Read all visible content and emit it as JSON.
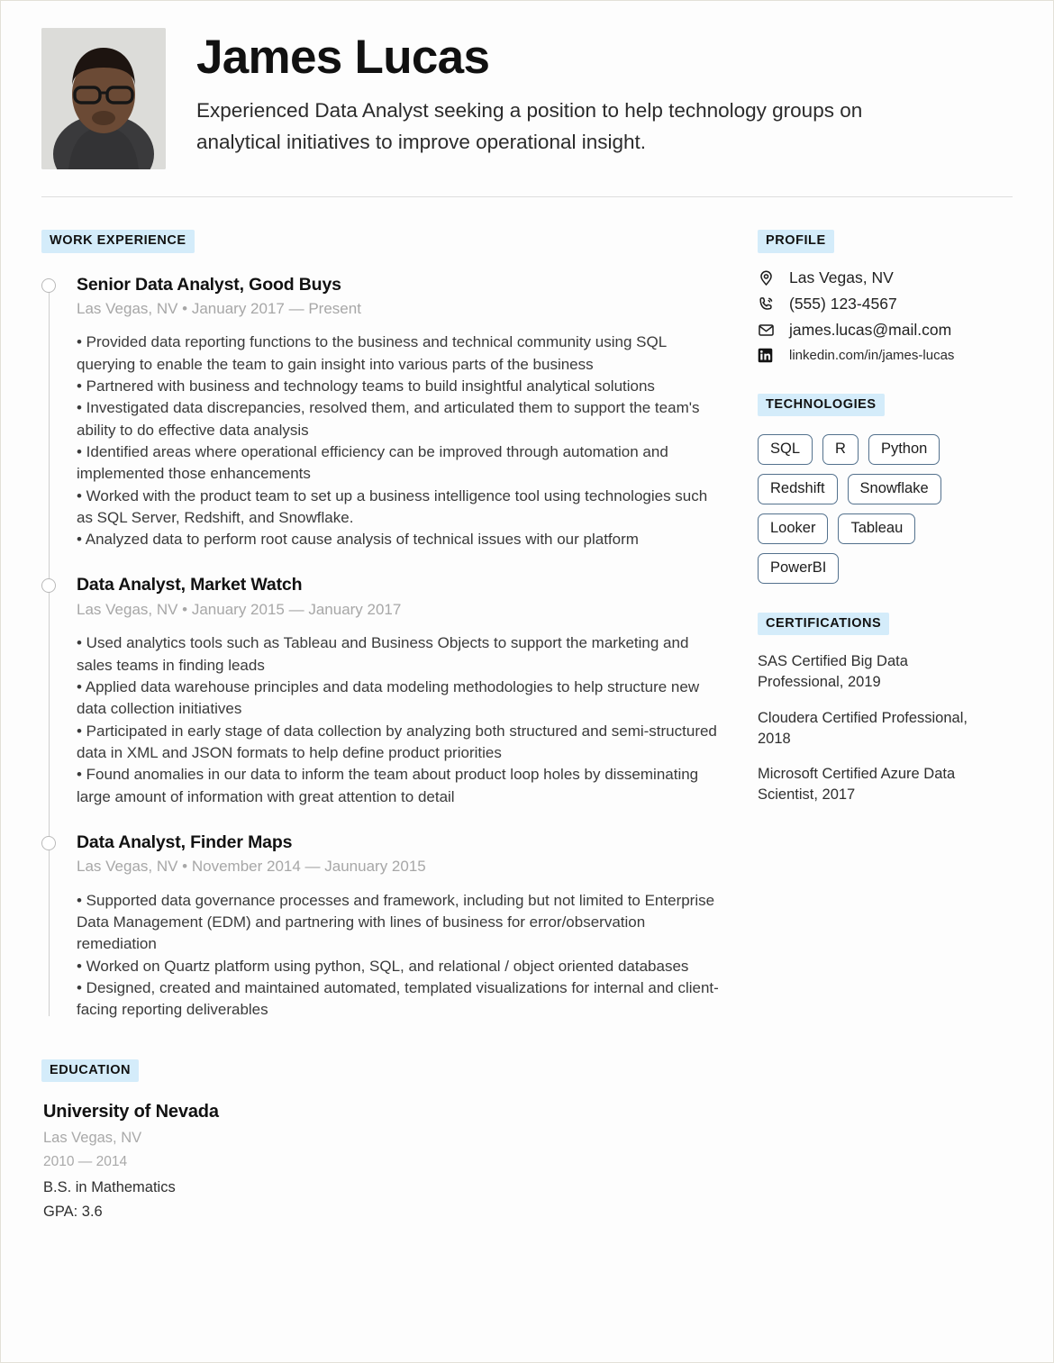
{
  "theme": {
    "chip_bg": "#d4ecfa",
    "tag_border": "#53718d",
    "muted_text": "#a7a7a7",
    "body_text": "#3a3a3a"
  },
  "header": {
    "name": "James Lucas",
    "tagline": "Experienced Data Analyst seeking a position to help technology groups on analytical initiatives to improve operational insight.",
    "photo_alt": "profile-photo"
  },
  "work": {
    "section_label": "WORK EXPERIENCE",
    "jobs": [
      {
        "title": "Senior Data Analyst, Good Buys",
        "meta": "Las Vegas, NV • January 2017 — Present",
        "bullets": [
          "• Provided data reporting functions to the business and technical community using SQL querying to enable the team to gain insight into various parts of the business",
          "• Partnered with business and technology teams to build insightful analytical solutions",
          "• Investigated data discrepancies, resolved them, and articulated them to support the team's ability to do effective data analysis",
          "• Identified areas where operational efficiency can be improved through automation and implemented those enhancements",
          "• Worked with the product team to set up a business intelligence tool using technologies such as SQL Server, Redshift, and Snowflake.",
          "• Analyzed data to perform root cause analysis of technical issues with our platform"
        ]
      },
      {
        "title": "Data Analyst, Market Watch",
        "meta": "Las Vegas, NV • January 2015 — January 2017",
        "bullets": [
          "• Used analytics tools such as Tableau and Business Objects to support the marketing and sales teams in finding leads",
          "• Applied data warehouse principles and data modeling methodologies to help structure new data collection initiatives",
          "• Participated in early stage of data collection by analyzing both structured and semi-structured data in XML and JSON formats to help define product priorities",
          "• Found anomalies in our data to inform the team about product loop holes by disseminating large amount of information with great attention to detail"
        ]
      },
      {
        "title": "Data Analyst, Finder Maps",
        "meta": "Las Vegas, NV • November 2014 — Jaunuary 2015",
        "bullets": [
          "• Supported data governance processes and framework, including but not limited to Enterprise Data Management (EDM) and partnering with lines of business for error/observation remediation",
          "• Worked on Quartz platform using python, SQL, and relational / object oriented databases",
          "• Designed, created and maintained automated, templated visualizations for internal and client-facing reporting deliverables"
        ]
      }
    ]
  },
  "education": {
    "section_label": "EDUCATION",
    "school": "University of Nevada",
    "location": "Las Vegas, NV",
    "years": "2010 — 2014",
    "degree": "B.S. in Mathematics",
    "gpa": "GPA: 3.6"
  },
  "profile": {
    "section_label": "PROFILE",
    "contacts": [
      {
        "icon": "location-pin-icon",
        "text": "Las Vegas, NV"
      },
      {
        "icon": "phone-icon",
        "text": "(555) 123-4567"
      },
      {
        "icon": "envelope-icon",
        "text": "james.lucas@mail.com"
      },
      {
        "icon": "linkedin-icon",
        "text": "linkedin.com/in/james-lucas"
      }
    ]
  },
  "technologies": {
    "section_label": "TECHNOLOGIES",
    "items": [
      "SQL",
      "R",
      "Python",
      "Redshift",
      "Snowflake",
      "Looker",
      "Tableau",
      "PowerBI"
    ]
  },
  "certifications": {
    "section_label": "CERTIFICATIONS",
    "items": [
      "SAS Certified Big Data Professional, 2019",
      "Cloudera Certified Professional, 2018",
      "Microsoft Certified Azure Data Scientist, 2017"
    ]
  }
}
